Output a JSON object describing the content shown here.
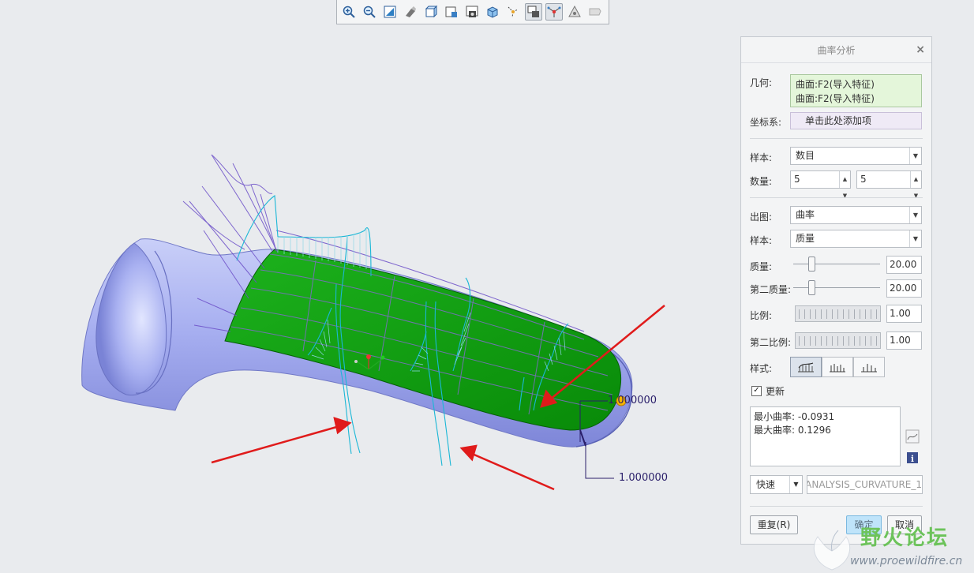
{
  "toolbar": {
    "icons": [
      "zoom-in-icon",
      "zoom-out-icon",
      "refit-icon",
      "orientation-icon",
      "view-box-icon",
      "saved-views-icon",
      "perspective-icon",
      "display-style-icon",
      "datum-display-icon",
      "annotation-display-icon",
      "curvature-display-icon",
      "spin-center-icon",
      "quality-icon"
    ]
  },
  "viewport": {
    "dim_label_1": "1.000000",
    "dim_label_2": "1.000000"
  },
  "panel": {
    "title": "曲率分析",
    "close": "×",
    "geometry_label": "几何:",
    "geometry_items": [
      "曲面:F2(导入特征)",
      "曲面:F2(导入特征)"
    ],
    "csys_label": "坐标系:",
    "csys_placeholder": "单击此处添加项",
    "sample_label": "样本:",
    "sample_value": "数目",
    "count_label": "数量:",
    "count_1": "5",
    "count_2": "5",
    "plot_label": "出图:",
    "plot_value": "曲率",
    "sample2_label": "样本:",
    "sample2_value": "质量",
    "quality_label": "质量:",
    "quality_value": "20.00",
    "quality_slider": 0.21,
    "quality2_label": "第二质量:",
    "quality2_value": "20.00",
    "quality2_slider": 0.21,
    "scale_label": "比例:",
    "scale_value": "1.00",
    "scale2_label": "第二比例:",
    "scale2_value": "1.00",
    "style_label": "样式:",
    "update_label": "更新",
    "update_checked": true,
    "min_curvature": "最小曲率: -0.0931",
    "max_curvature": "最大曲率: 0.1296",
    "mode_value": "快速",
    "analysis_name": "ANALYSIS_CURVATURE_1",
    "repeat_button": "重复(R)",
    "ok_button": "确定",
    "cancel_button": "取消"
  },
  "watermark": {
    "text": "野火论坛",
    "url": "www.proewildfire.cn"
  },
  "colors": {
    "surface": "#a9b2f0",
    "green_face": "#0fa10f",
    "comb": "#1fb8d8",
    "arrow": "#e01b1b"
  }
}
